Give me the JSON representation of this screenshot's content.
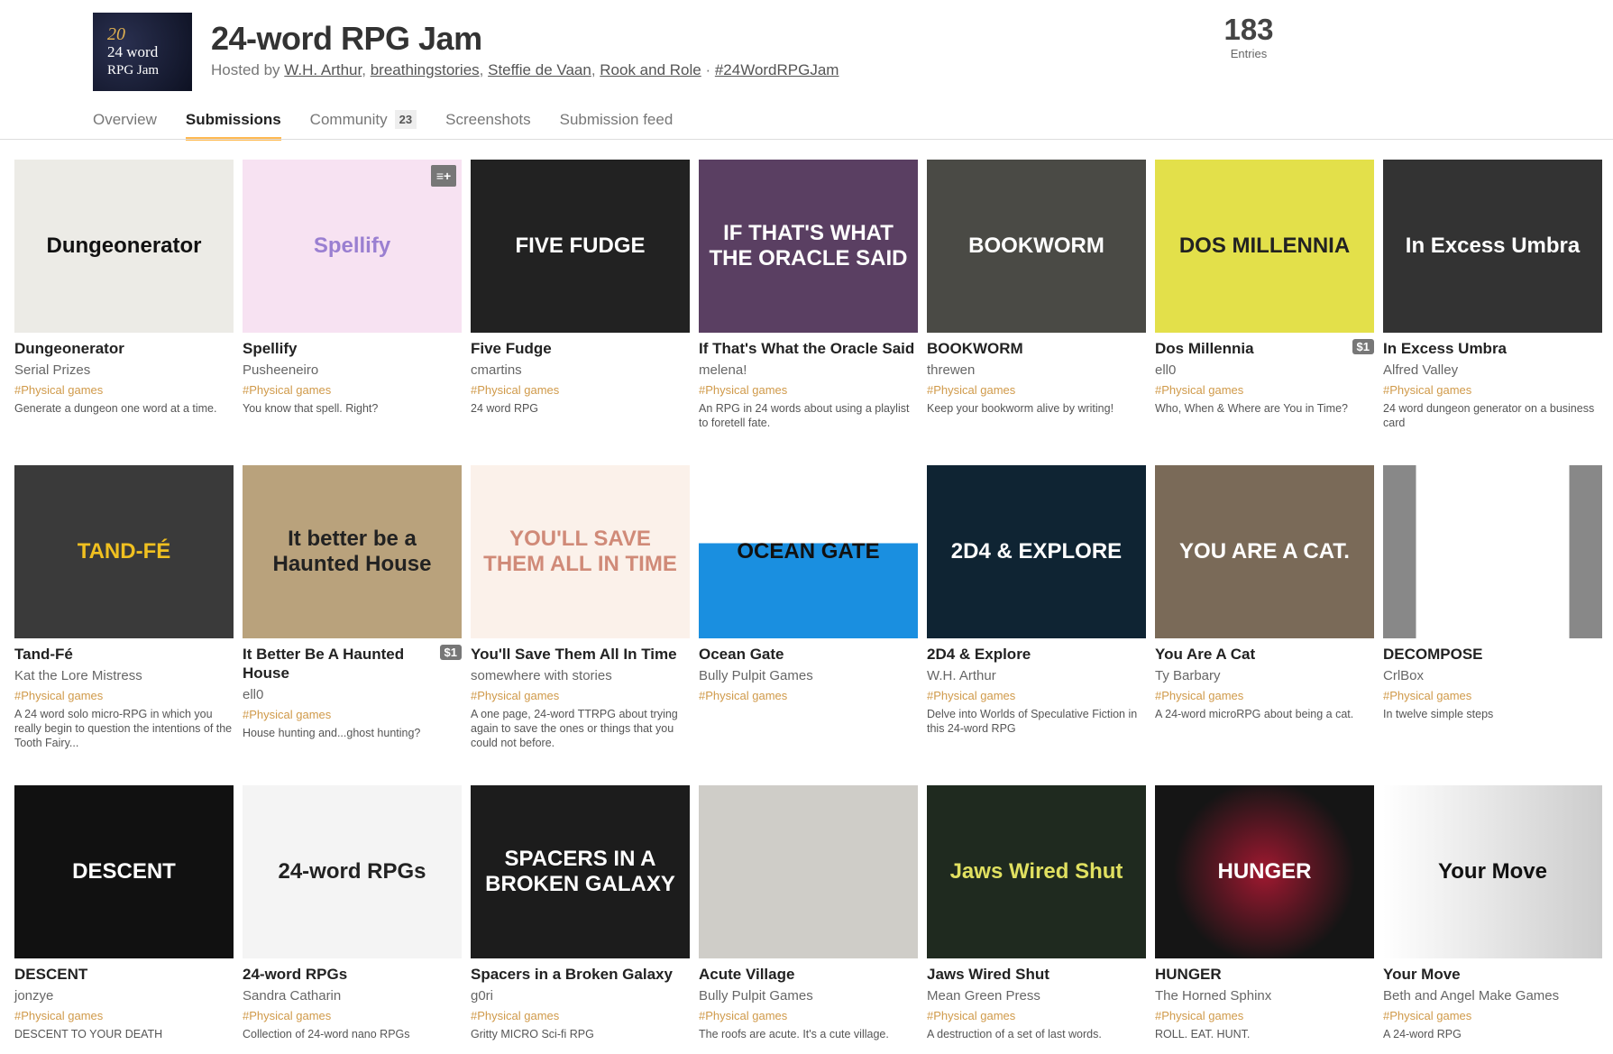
{
  "jam": {
    "logo_text": [
      "20",
      "24 word",
      "RPG Jam"
    ],
    "title": "24-word RPG Jam",
    "hosted_prefix": "Hosted by ",
    "hosts": [
      "W.H. Arthur",
      "breathingstories",
      "Steffie de Vaan",
      "Rook and Role"
    ],
    "hashtag": "#24WordRPGJam",
    "entries_count": "183",
    "entries_label": "Entries"
  },
  "tabs": [
    {
      "label": "Overview"
    },
    {
      "label": "Submissions",
      "active": true
    },
    {
      "label": "Community",
      "count": "23"
    },
    {
      "label": "Screenshots"
    },
    {
      "label": "Submission feed"
    }
  ],
  "colors": {
    "accent": "#ffb84f",
    "tag": "#d09a4a",
    "price_badge": "#777777"
  },
  "games": [
    {
      "title": "Dungeonerator",
      "author": "Serial Prizes",
      "tag": "#Physical games",
      "desc": "Generate a dungeon one word at a time.",
      "thumb_text": "Dungeonerator",
      "bg": "#ecebe6",
      "fg": "#111"
    },
    {
      "title": "Spellify",
      "author": "Pusheeneiro",
      "tag": "#Physical games",
      "desc": "You know that spell. Right?",
      "thumb_text": "Spellify",
      "bg": "#f7e2f2",
      "fg": "#9a7fd1",
      "add_icon": true
    },
    {
      "title": "Five Fudge",
      "author": "cmartins",
      "tag": "#Physical games",
      "desc": "24 word RPG",
      "thumb_text": "FIVE FUDGE",
      "bg": "#222",
      "fg": "#fff"
    },
    {
      "title": "If That's What the Oracle Said",
      "author": "melena!",
      "tag": "#Physical games",
      "desc": "An RPG in 24 words about using a playlist to foretell fate.",
      "thumb_text": "IF THAT'S WHAT THE ORACLE SAID",
      "bg": "#5a3f62",
      "fg": "#fff"
    },
    {
      "title": "BOOKWORM",
      "author": "threwen",
      "tag": "#Physical games",
      "desc": "Keep your bookworm alive by writing!",
      "thumb_text": "BOOKWORM",
      "bg": "#4a4a45",
      "fg": "#fff"
    },
    {
      "title": "Dos Millennia",
      "author": "ell0",
      "tag": "#Physical games",
      "desc": "Who, When & Where are You in Time?",
      "thumb_text": "DOS MILLENNIA",
      "bg": "#e3e04a",
      "fg": "#222",
      "price": "$1"
    },
    {
      "title": "In Excess Umbra",
      "author": "Alfred Valley",
      "tag": "#Physical games",
      "desc": "24 word dungeon generator on a business card",
      "thumb_text": "In Excess Umbra",
      "bg": "#333",
      "fg": "#fff"
    },
    {
      "title": "Tand-Fé",
      "author": "Kat the Lore Mistress",
      "tag": "#Physical games",
      "desc": "A 24 word solo micro-RPG in which you really begin to question the intentions of the Tooth Fairy...",
      "thumb_text": "TAND-FÉ",
      "bg": "#3a3a3a",
      "fg": "#f0c020"
    },
    {
      "title": "It Better Be A Haunted House",
      "author": "ell0",
      "tag": "#Physical games",
      "desc": "House hunting and...ghost hunting?",
      "thumb_text": "It better be a Haunted House",
      "bg": "#b9a27c",
      "fg": "#222",
      "price": "$1"
    },
    {
      "title": "You'll Save Them All In Time",
      "author": "somewhere with stories",
      "tag": "#Physical games",
      "desc": "A one page, 24-word TTRPG about trying again to save the ones or things that you could not before.",
      "thumb_text": "YOU'LL SAVE THEM ALL IN TIME",
      "bg": "#fbf1ea",
      "fg": "#d08a78"
    },
    {
      "title": "Ocean Gate",
      "author": "Bully Pulpit Games",
      "tag": "#Physical games",
      "desc": "",
      "thumb_text": "OCEAN GATE",
      "bg": "linear-gradient(#fff 0 45%,#1a8fe0 45%)",
      "fg": "#111"
    },
    {
      "title": "2D4 & Explore",
      "author": "W.H. Arthur",
      "tag": "#Physical games",
      "desc": "Delve into Worlds of Speculative Fiction in this 24-word RPG",
      "thumb_text": "2D4 & EXPLORE",
      "bg": "#0f2433",
      "fg": "#fff"
    },
    {
      "title": "You Are A Cat",
      "author": "Ty Barbary",
      "tag": "#Physical games",
      "desc": "A 24-word microRPG about being a cat.",
      "thumb_text": "YOU ARE A CAT.",
      "bg": "#7a6a58",
      "fg": "#fff"
    },
    {
      "title": "DECOMPOSE",
      "author": "CrlBox",
      "tag": "#Physical games",
      "desc": "In twelve simple steps",
      "thumb_text": "",
      "bg": "linear-gradient(90deg,#888 0 15%,#fff 15% 85%,#888 85%)",
      "fg": "#222"
    },
    {
      "title": "DESCENT",
      "author": "jonzye",
      "tag": "#Physical games",
      "desc": "DESCENT TO YOUR DEATH",
      "thumb_text": "DESCENT",
      "bg": "#111",
      "fg": "#fff"
    },
    {
      "title": "24-word RPGs",
      "author": "Sandra Catharin",
      "tag": "#Physical games",
      "desc": "Collection of 24-word nano RPGs",
      "thumb_text": "24-word RPGs",
      "bg": "#f4f4f4",
      "fg": "#222"
    },
    {
      "title": "Spacers in a Broken Galaxy",
      "author": "g0ri",
      "tag": "#Physical games",
      "desc": "Gritty MICRO Sci-fi RPG",
      "thumb_text": "SPACERS IN A BROKEN GALAXY",
      "bg": "#1c1c1c",
      "fg": "#fff"
    },
    {
      "title": "Acute Village",
      "author": "Bully Pulpit Games",
      "tag": "#Physical games",
      "desc": "The roofs are acute. It's a cute village.",
      "thumb_text": "",
      "bg": "#cfcdc8",
      "fg": "#222"
    },
    {
      "title": "Jaws Wired Shut",
      "author": "Mean Green Press",
      "tag": "#Physical games",
      "desc": "A destruction of a set of last words.",
      "thumb_text": "Jaws Wired Shut",
      "bg": "#1f2a1f",
      "fg": "#e0e060"
    },
    {
      "title": "HUNGER",
      "author": "The Horned Sphinx",
      "tag": "#Physical games",
      "desc": "ROLL. EAT. HUNT.",
      "thumb_text": "HUNGER",
      "bg": "radial-gradient(circle,#a01830,#151515 65%)",
      "fg": "#fff"
    },
    {
      "title": "Your Move",
      "author": "Beth and Angel Make Games",
      "tag": "#Physical games",
      "desc": "A 24-word RPG",
      "thumb_text": "Your Move",
      "bg": "linear-gradient(90deg,#fff,#ccc)",
      "fg": "#111"
    }
  ]
}
